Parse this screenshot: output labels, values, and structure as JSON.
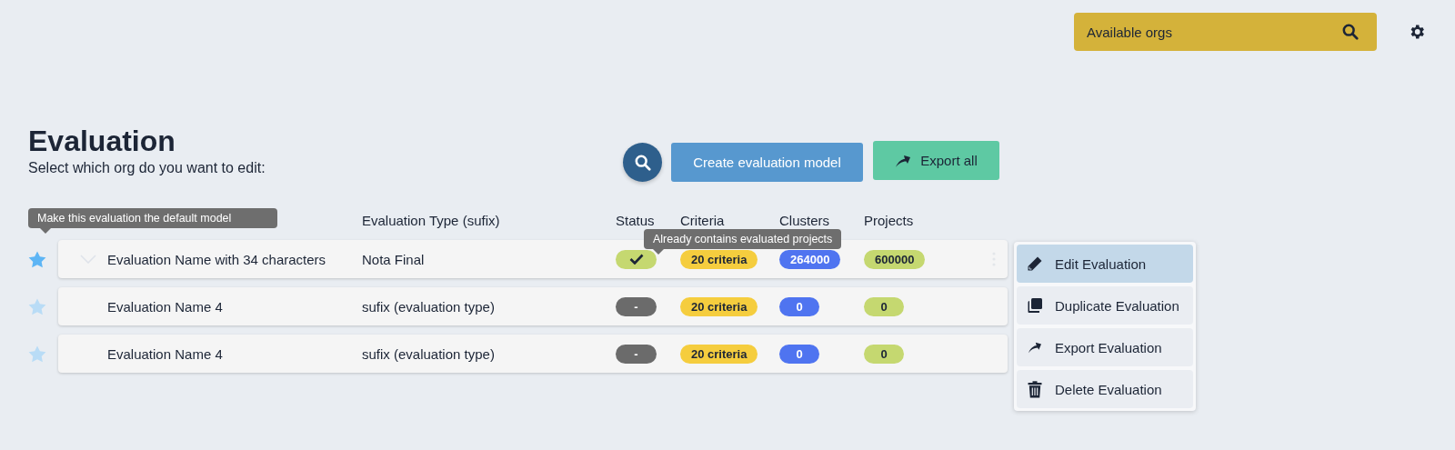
{
  "org_picker": {
    "label": "Available orgs"
  },
  "page": {
    "title": "Evaluation",
    "subtitle": "Select which org do you want to edit:"
  },
  "toolbar": {
    "create_button": "Create evaluation model",
    "export_button": "Export all"
  },
  "table": {
    "columns": [
      "Evaluation Type (sufix)",
      "Status",
      "Criteria",
      "Clusters",
      "Projects"
    ],
    "rows": [
      {
        "default": true,
        "hovered": true,
        "name": "Evaluation Name with 34 characters",
        "type": "Nota Final",
        "status": {
          "kind": "done"
        },
        "criteria": "20 criteria",
        "clusters": "264000",
        "projects": "600000"
      },
      {
        "default": false,
        "hovered": false,
        "name": "Evaluation Name 4",
        "type": "sufix (evaluation type)",
        "status": {
          "kind": "none",
          "text": "-"
        },
        "criteria": "20 criteria",
        "clusters": "0",
        "projects": "0"
      },
      {
        "default": false,
        "hovered": false,
        "name": "Evaluation Name 4",
        "type": "sufix (evaluation type)",
        "status": {
          "kind": "none",
          "text": "-"
        },
        "criteria": "20 criteria",
        "clusters": "0",
        "projects": "0"
      }
    ]
  },
  "tooltips": {
    "star": "Make this evaluation the default model",
    "status": "Already contains evaluated projects"
  },
  "row_menu": [
    {
      "kind": "edit",
      "label": "Edit Evaluation",
      "selected": true
    },
    {
      "kind": "duplicate",
      "label": "Duplicate Evaluation",
      "selected": false
    },
    {
      "kind": "export",
      "label": "Export Evaluation",
      "selected": false
    },
    {
      "kind": "delete",
      "label": "Delete Evaluation",
      "selected": false
    }
  ]
}
